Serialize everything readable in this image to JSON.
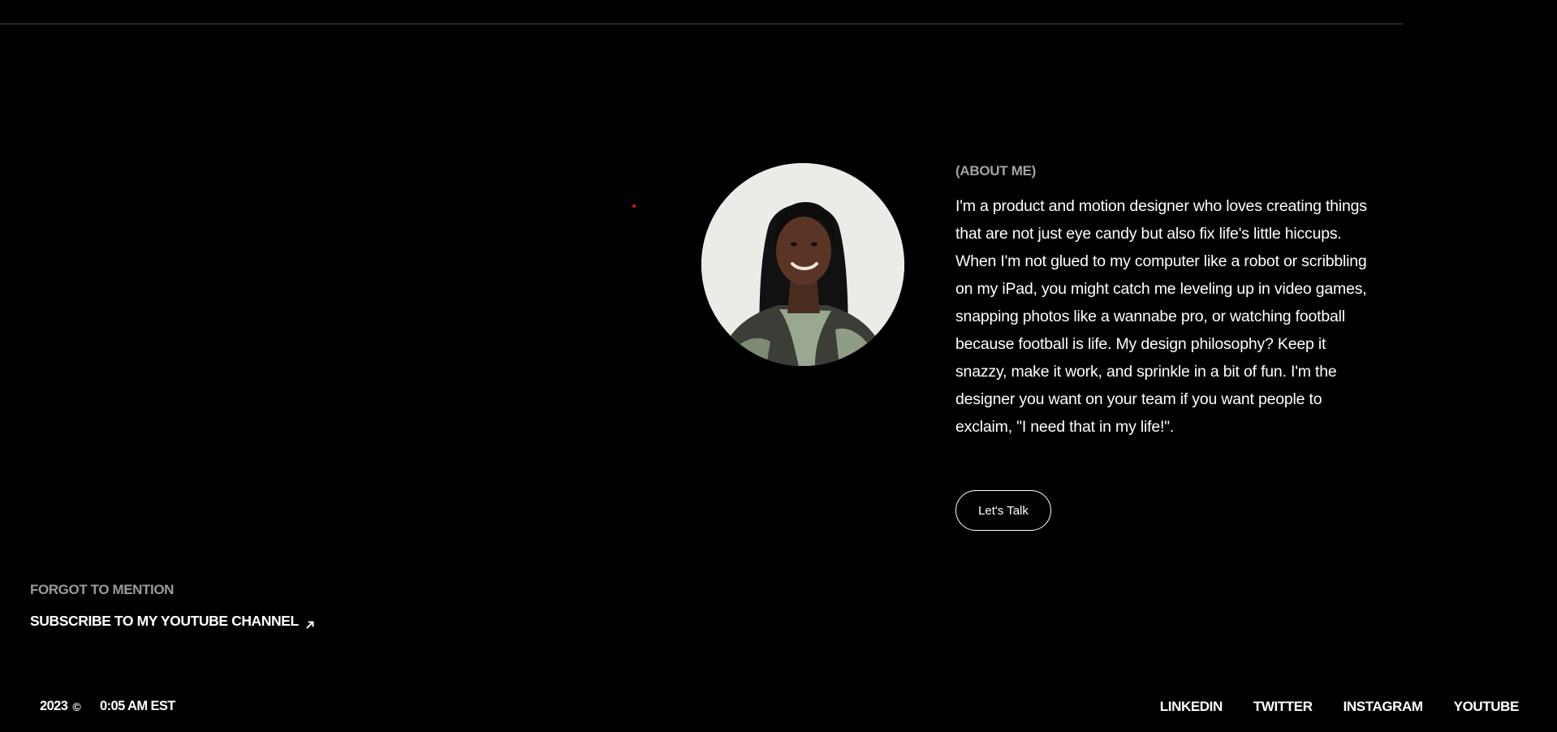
{
  "about": {
    "label": "(ABOUT ME)",
    "body": "I'm a product and motion designer who loves creating things that are not just eye candy but also fix life's little hiccups. When I'm not glued to my computer like a robot or scribbling on my iPad, you might catch me leveling up in video games, snapping photos like a wannabe pro, or watching football because football is life. My design philosophy? Keep it snazzy, make it work, and sprinkle in a bit of fun. I'm the designer you want on your team if you want people to exclaim, \"I need that in my life!\".",
    "cta_label": "Let's Talk"
  },
  "forgot": {
    "label": "FORGOT TO MENTION",
    "subscribe_label": "SUBSCRIBE TO MY YOUTUBE CHANNEL"
  },
  "footer": {
    "year": "2023",
    "copyright_symbol": "©",
    "time": "0:05 AM EST",
    "social": [
      "LINKEDIN",
      "TWITTER",
      "INSTAGRAM",
      "YOUTUBE"
    ]
  },
  "colors": {
    "background": "#000000",
    "text": "#ffffff",
    "muted": "#a3a3a3",
    "rule": "#4a4a4a",
    "cursor_dot": "#d11a1a"
  },
  "icons": {
    "subscribe_arrow": "arrow-up-right-icon",
    "copyright": "copyright-icon"
  }
}
